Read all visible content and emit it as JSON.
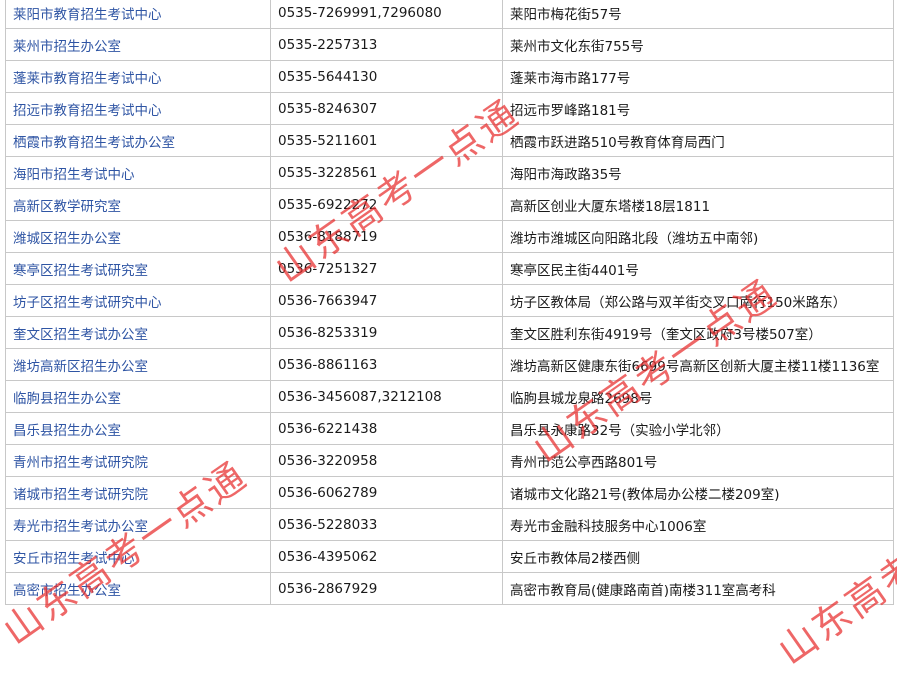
{
  "table": {
    "rows": [
      {
        "name": "莱阳市教育招生考试中心",
        "phone": "0535-7269991,7296080",
        "address": "莱阳市梅花街57号"
      },
      {
        "name": "莱州市招生办公室",
        "phone": "0535-2257313",
        "address": "莱州市文化东街755号"
      },
      {
        "name": "蓬莱市教育招生考试中心",
        "phone": "0535-5644130",
        "address": "蓬莱市海市路177号"
      },
      {
        "name": "招远市教育招生考试中心",
        "phone": "0535-8246307",
        "address": "招远市罗峰路181号"
      },
      {
        "name": "栖霞市教育招生考试办公室",
        "phone": "0535-5211601",
        "address": "栖霞市跃进路510号教育体育局西门"
      },
      {
        "name": "海阳市招生考试中心",
        "phone": "0535-3228561",
        "address": "海阳市海政路35号"
      },
      {
        "name": "高新区教学研究室",
        "phone": "0535-6922272",
        "address": "高新区创业大厦东塔楼18层1811"
      },
      {
        "name": "潍城区招生办公室",
        "phone": "0536-8188719",
        "address": "潍坊市潍城区向阳路北段（潍坊五中南邻)"
      },
      {
        "name": "寒亭区招生考试研究室",
        "phone": "0536-7251327",
        "address": "寒亭区民主街4401号"
      },
      {
        "name": "坊子区招生考试研究中心",
        "phone": "0536-7663947",
        "address": "坊子区教体局（郑公路与双羊街交叉口南行150米路东）"
      },
      {
        "name": "奎文区招生考试办公室",
        "phone": "0536-8253319",
        "address": "奎文区胜利东街4919号（奎文区政府3号楼507室）"
      },
      {
        "name": "潍坊高新区招生办公室",
        "phone": "0536-8861163",
        "address": "潍坊高新区健康东街6699号高新区创新大厦主楼11楼1136室"
      },
      {
        "name": "临朐县招生办公室",
        "phone": "0536-3456087,3212108",
        "address": "临朐县城龙泉路2698号"
      },
      {
        "name": "昌乐县招生办公室",
        "phone": "0536-6221438",
        "address": "昌乐县永康路32号（实验小学北邻）"
      },
      {
        "name": "青州市招生考试研究院",
        "phone": "0536-3220958",
        "address": "青州市范公亭西路801号"
      },
      {
        "name": "诸城市招生考试研究院",
        "phone": "0536-6062789",
        "address": "诸城市文化路21号(教体局办公楼二楼209室)"
      },
      {
        "name": "寿光市招生考试办公室",
        "phone": "0536-5228033",
        "address": "寿光市金融科技服务中心1006室"
      },
      {
        "name": "安丘市招生考试中心",
        "phone": "0536-4395062",
        "address": "安丘市教体局2楼西侧"
      },
      {
        "name": "高密市招生办公室",
        "phone": "0536-2867929",
        "address": "高密市教育局(健康路南首)南楼311室高考科"
      }
    ]
  },
  "watermark": {
    "text": "山东高考一点通",
    "color": "#e82d2d"
  }
}
